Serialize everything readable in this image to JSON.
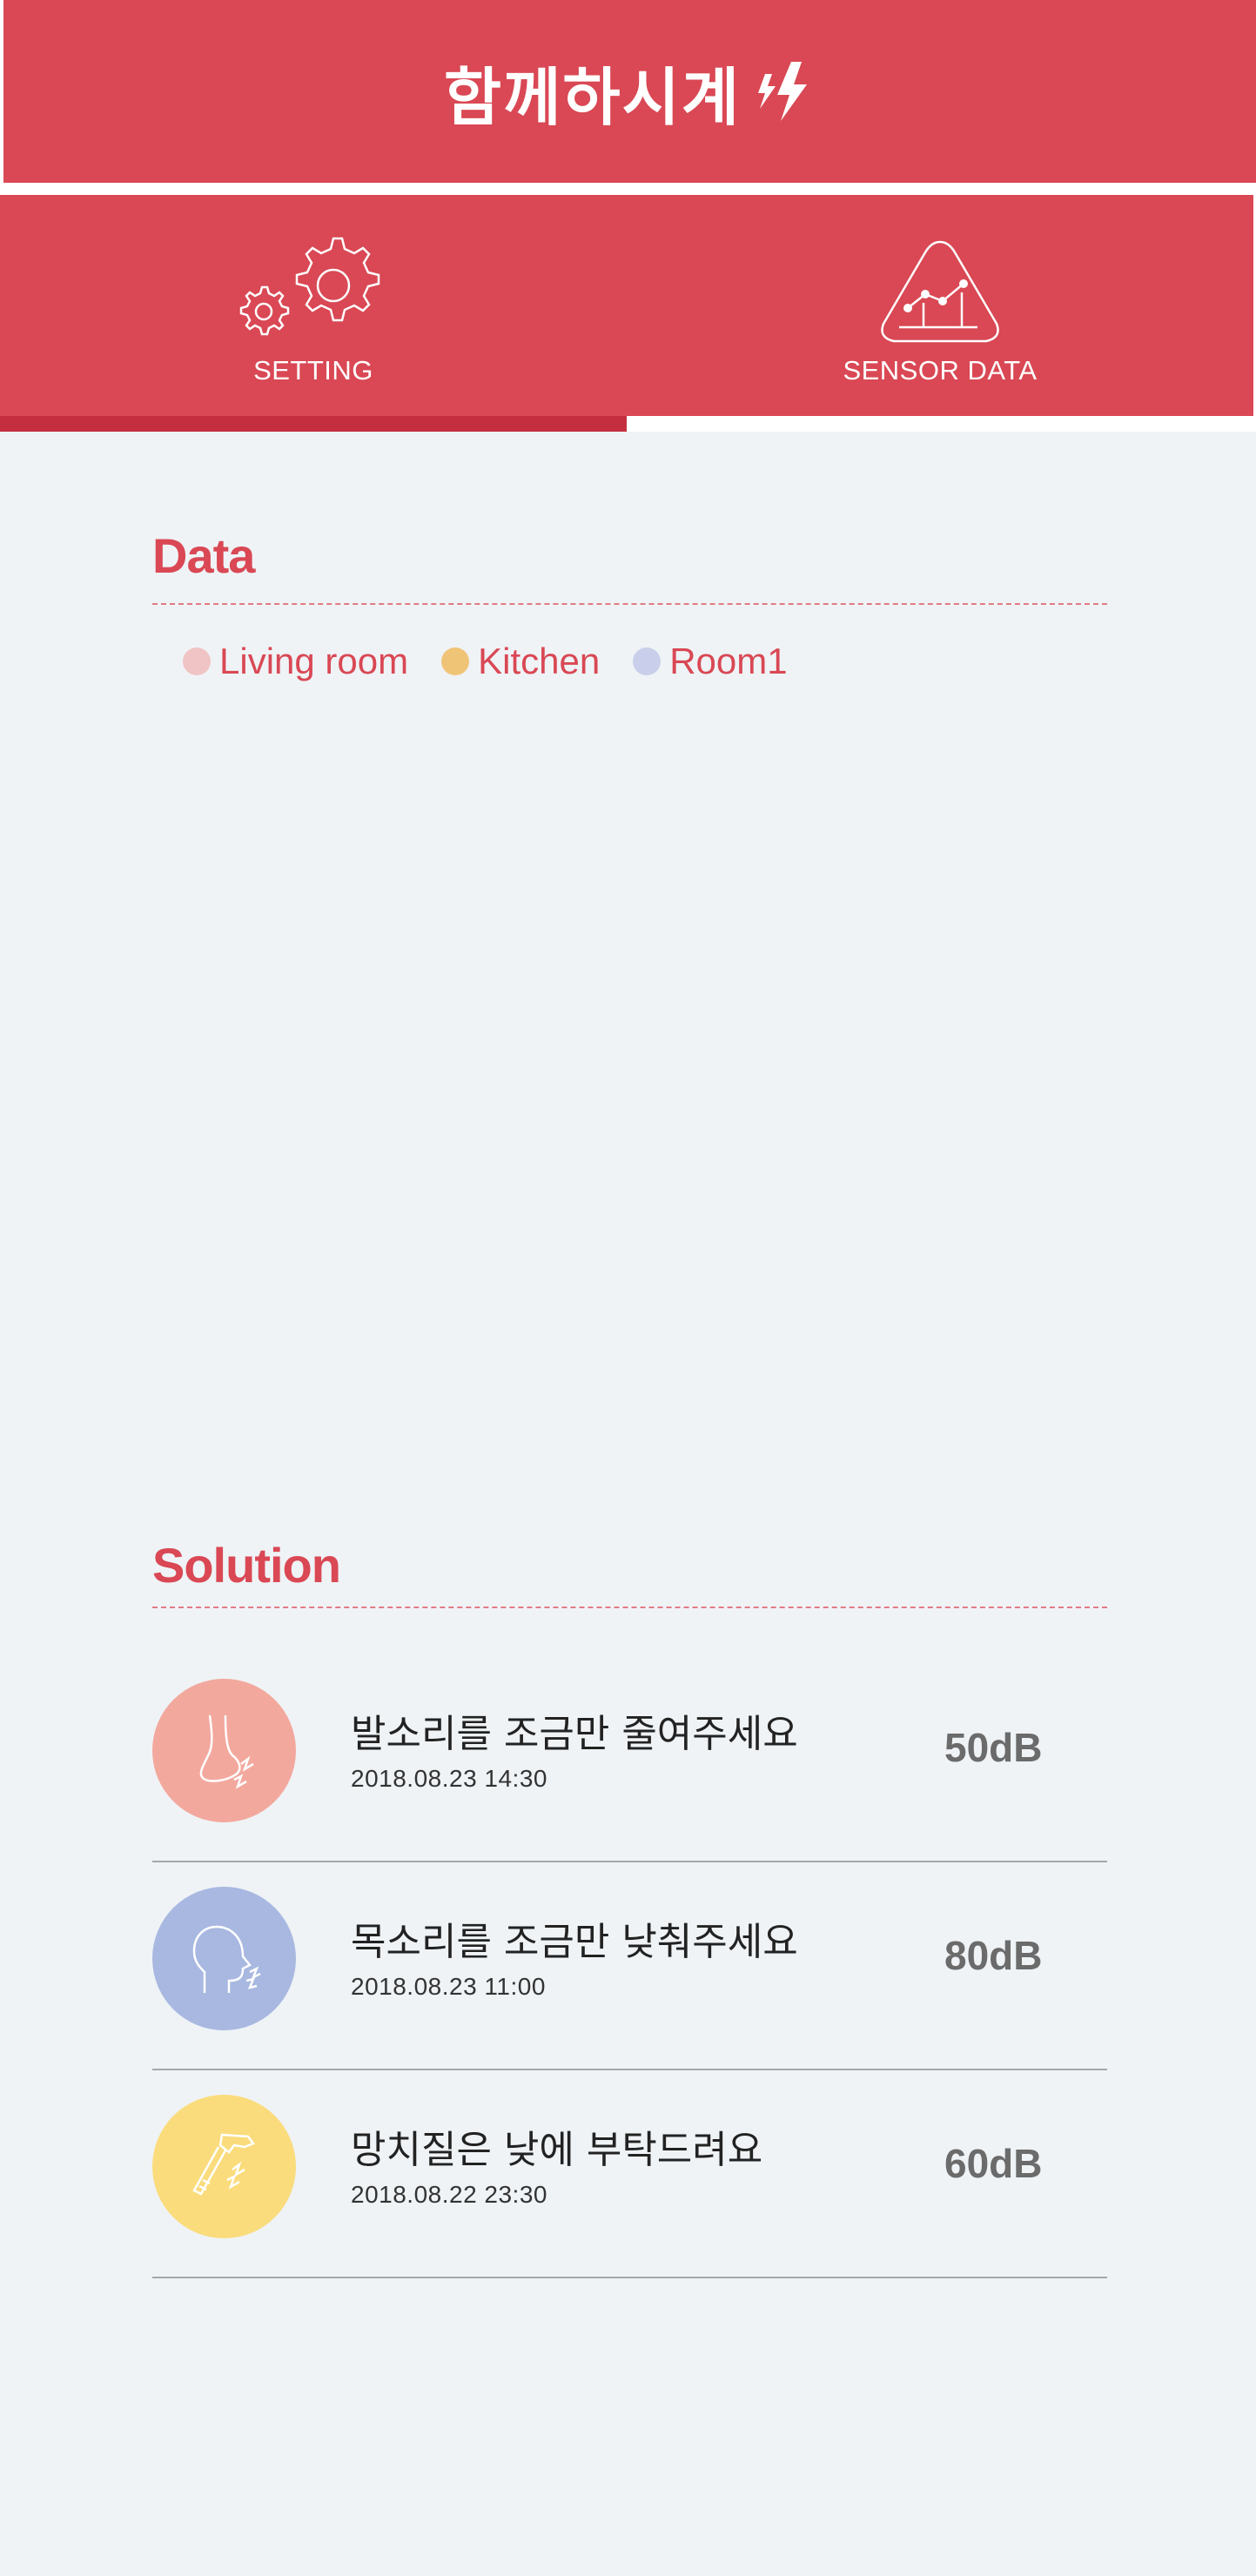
{
  "app": {
    "title": "함께하시계"
  },
  "tabs": [
    {
      "label": "SETTING",
      "icon": "gears-icon",
      "active": true
    },
    {
      "label": "SENSOR DATA",
      "icon": "line-chart-icon",
      "active": false
    }
  ],
  "data_section": {
    "title": "Data",
    "legend": [
      {
        "label": "Living room",
        "color": "#f0c4c4"
      },
      {
        "label": "Kitchen",
        "color": "#f0c477"
      },
      {
        "label": "Room1",
        "color": "#c9cfea"
      }
    ]
  },
  "solution_section": {
    "title": "Solution",
    "items": [
      {
        "message": "발소리를 조금만 줄여주세요",
        "time": "2018.08.23 14:30",
        "level": "50dB",
        "icon": "foot-icon",
        "color": "#f3a89e"
      },
      {
        "message": "목소리를 조금만 낮춰주세요",
        "time": "2018.08.23 11:00",
        "level": "80dB",
        "icon": "voice-icon",
        "color": "#a8b8e0"
      },
      {
        "message": "망치질은 낮에 부탁드려요",
        "time": "2018.08.22 23:30",
        "level": "60dB",
        "icon": "hammer-icon",
        "color": "#fadc7c"
      }
    ]
  },
  "colors": {
    "brand": "#d94854",
    "indicator": "#c42e3e",
    "background": "#eff3f6"
  }
}
